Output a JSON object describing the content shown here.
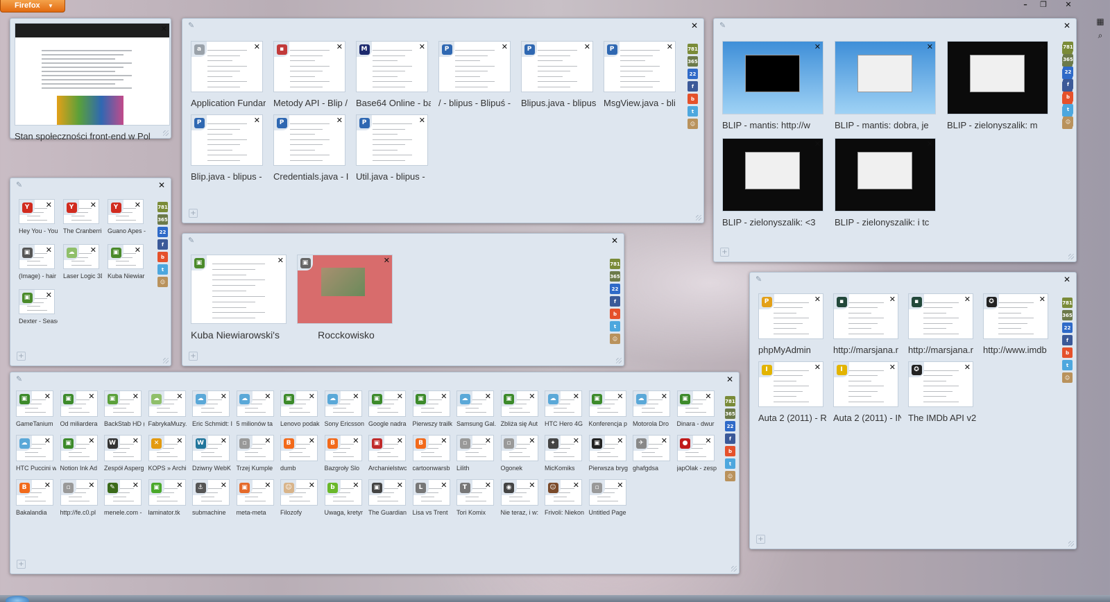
{
  "app": {
    "menu_label": "Firefox"
  },
  "window_controls": {
    "minimize": "–",
    "restore": "❐",
    "close": "✕"
  },
  "colors": {
    "group_bg": "#dee6ef",
    "group_border": "#b5c3d3",
    "firefox_orange": "#e8720c"
  },
  "app_tabs": [
    {
      "name": "counter-781",
      "color": "#7a8b38",
      "label": "781"
    },
    {
      "name": "counter-365",
      "color": "#6c7a4a",
      "label": "365"
    },
    {
      "name": "calendar-22",
      "color": "#2f6ac8",
      "label": "22"
    },
    {
      "name": "facebook",
      "color": "#3b5998",
      "label": "f"
    },
    {
      "name": "blip",
      "color": "#e5512b",
      "label": "b"
    },
    {
      "name": "twitter",
      "color": "#4da7de",
      "label": "t"
    },
    {
      "name": "avatar",
      "color": "#b9925c",
      "label": "☺"
    }
  ],
  "groups": {
    "g1": {
      "tabs": [
        {
          "title": "Stan społeczności front-end w Pol"
        }
      ]
    },
    "g2": {
      "tabs": [
        {
          "title": "Application Fundar",
          "icon": "a",
          "icon_color": "#9aa2aa"
        },
        {
          "title": "Metody API - Blip /",
          "icon": "▪",
          "icon_color": "#c23a3a"
        },
        {
          "title": "Base64 Online - ba",
          "icon": "M",
          "icon_color": "#1d2a6e"
        },
        {
          "title": "/ - blipus - Blipuś -",
          "icon": "P",
          "icon_color": "#2f68b2"
        },
        {
          "title": "Blipus.java - blipus",
          "icon": "P",
          "icon_color": "#2f68b2"
        },
        {
          "title": "MsgView.java - bli",
          "icon": "P",
          "icon_color": "#2f68b2"
        },
        {
          "title": "Blip.java - blipus -",
          "icon": "P",
          "icon_color": "#2f68b2"
        },
        {
          "title": "Credentials.java - I",
          "icon": "P",
          "icon_color": "#2f68b2"
        },
        {
          "title": "Util.java - blipus -",
          "icon": "P",
          "icon_color": "#2f68b2"
        }
      ]
    },
    "g3": {
      "tabs": [
        {
          "title": "BLIP - mantis: http://w"
        },
        {
          "title": "BLIP - mantis: dobra, je"
        },
        {
          "title": "BLIP - zielonyszalik: m"
        },
        {
          "title": "BLIP - zielonyszalik: <3"
        },
        {
          "title": "BLIP - zielonyszalik: i tc"
        }
      ]
    },
    "g4": {
      "tabs": [
        {
          "title": "Hey You - You",
          "icon": "Y",
          "icon_color": "#d12b1f"
        },
        {
          "title": "The Cranberri",
          "icon": "Y",
          "icon_color": "#d12b1f"
        },
        {
          "title": "Guano Apes -",
          "icon": "Y",
          "icon_color": "#d12b1f"
        },
        {
          "title": "(Image) - hair",
          "icon": "▣",
          "icon_color": "#555"
        },
        {
          "title": "Laser Logic 3D",
          "icon": "☁",
          "icon_color": "#8fbf6a"
        },
        {
          "title": "Kuba Niewiar",
          "icon": "▣",
          "icon_color": "#4a8a2a"
        },
        {
          "title": "Dexter - Seasc",
          "icon": "▣",
          "icon_color": "#4a8a2a"
        }
      ]
    },
    "g5": {
      "tabs": [
        {
          "title": "Kuba Niewiarowski's",
          "icon": "▣",
          "icon_color": "#4a8a2a"
        },
        {
          "title": "Rocckowisko",
          "icon": "▣",
          "icon_color": "#666"
        }
      ]
    },
    "g6": {
      "tabs": [
        {
          "title": "phpMyAdmin",
          "icon": "P",
          "icon_color": "#e3a018"
        },
        {
          "title": "http://marsjana.r",
          "icon": "▪",
          "icon_color": "#22483a"
        },
        {
          "title": "http://marsjana.r",
          "icon": "▪",
          "icon_color": "#22483a"
        },
        {
          "title": "http://www.imdb",
          "icon": "✪",
          "icon_color": "#222"
        },
        {
          "title": "Auta 2 (2011) - R",
          "icon": "I",
          "icon_color": "#e3b400"
        },
        {
          "title": "Auta 2 (2011) - IN",
          "icon": "I",
          "icon_color": "#e3b400"
        },
        {
          "title": "The IMDb API v2",
          "icon": "✪",
          "icon_color": "#222"
        }
      ]
    },
    "g7": {
      "tabs": [
        {
          "title": "GameTanium",
          "icon": "▣",
          "icon_color": "#3c8a2a"
        },
        {
          "title": "Od miliardera",
          "icon": "▣",
          "icon_color": "#3c8a2a"
        },
        {
          "title": "BackStab HD (",
          "icon": "▣",
          "icon_color": "#5aa03a"
        },
        {
          "title": "FabrykaMuzy.",
          "icon": "☁",
          "icon_color": "#8fbf6a"
        },
        {
          "title": "Eric Schmidt: I",
          "icon": "☁",
          "icon_color": "#5aa8d8"
        },
        {
          "title": "5 milionów ta",
          "icon": "☁",
          "icon_color": "#5aa8d8"
        },
        {
          "title": "Lenovo podak",
          "icon": "▣",
          "icon_color": "#3c8a2a"
        },
        {
          "title": "Sony Ericsson",
          "icon": "☁",
          "icon_color": "#5aa8d8"
        },
        {
          "title": "Google nadra",
          "icon": "▣",
          "icon_color": "#3c8a2a"
        },
        {
          "title": "Pierwszy trailk",
          "icon": "▣",
          "icon_color": "#3c8a2a"
        },
        {
          "title": "Samsung Gal.",
          "icon": "☁",
          "icon_color": "#5aa8d8"
        },
        {
          "title": "Zbliża się Aut",
          "icon": "▣",
          "icon_color": "#3c8a2a"
        },
        {
          "title": "HTC Hero 4G",
          "icon": "☁",
          "icon_color": "#5aa8d8"
        },
        {
          "title": "Konferencja p",
          "icon": "▣",
          "icon_color": "#3c8a2a"
        },
        {
          "title": "Motorola Dro",
          "icon": "☁",
          "icon_color": "#5aa8d8"
        },
        {
          "title": "Dinara - dwur",
          "icon": "▣",
          "icon_color": "#3c8a2a"
        },
        {
          "title": "HTC Puccini w",
          "icon": "☁",
          "icon_color": "#5aa8d8"
        },
        {
          "title": "Notion Ink Ad",
          "icon": "▣",
          "icon_color": "#3c8a2a"
        },
        {
          "title": "Zespół Asperg",
          "icon": "W",
          "icon_color": "#333"
        },
        {
          "title": "KOPS » Archi",
          "icon": "✕",
          "icon_color": "#e39a10"
        },
        {
          "title": "Dziwny WebK",
          "icon": "W",
          "icon_color": "#21759b"
        },
        {
          "title": "Trzej Kumple",
          "icon": "▫",
          "icon_color": "#999"
        },
        {
          "title": "dumb",
          "icon": "B",
          "icon_color": "#f26a1b"
        },
        {
          "title": "Bazgroły Slo",
          "icon": "B",
          "icon_color": "#f26a1b"
        },
        {
          "title": "Archanielstwc",
          "icon": "▣",
          "icon_color": "#c02a2a"
        },
        {
          "title": "cartoonwarsb",
          "icon": "B",
          "icon_color": "#f26a1b"
        },
        {
          "title": "Lilith",
          "icon": "▫",
          "icon_color": "#999"
        },
        {
          "title": "Ogonek",
          "icon": "▫",
          "icon_color": "#999"
        },
        {
          "title": "MicKomiks",
          "icon": "✦",
          "icon_color": "#444"
        },
        {
          "title": "Pierwsza bryg",
          "icon": "▣",
          "icon_color": "#222"
        },
        {
          "title": "ghafgdsa",
          "icon": "✈",
          "icon_color": "#888"
        },
        {
          "title": "japOlak - zesp",
          "icon": "●",
          "icon_color": "#c01a1a"
        },
        {
          "title": "Bakalandia",
          "icon": "B",
          "icon_color": "#f26a1b"
        },
        {
          "title": "http://fe.c0.pl",
          "icon": "▫",
          "icon_color": "#999"
        },
        {
          "title": "menele.com -",
          "icon": "✎",
          "icon_color": "#3a6a1a"
        },
        {
          "title": "laminator.tk",
          "icon": "▣",
          "icon_color": "#4aa82a"
        },
        {
          "title": "submachine",
          "icon": "⚓",
          "icon_color": "#555"
        },
        {
          "title": "meta-meta",
          "icon": "▣",
          "icon_color": "#e56a2a"
        },
        {
          "title": "Filozofy",
          "icon": "☺",
          "icon_color": "#d8b48a"
        },
        {
          "title": "Uwaga, kretyr",
          "icon": "b",
          "icon_color": "#6ab82a"
        },
        {
          "title": "The Guardian",
          "icon": "▣",
          "icon_color": "#444"
        },
        {
          "title": "Lisa vs Trent",
          "icon": "L",
          "icon_color": "#777"
        },
        {
          "title": "Tori Komix",
          "icon": "T",
          "icon_color": "#777"
        },
        {
          "title": "Nie teraz, i w:",
          "icon": "◉",
          "icon_color": "#444"
        },
        {
          "title": "Frivoli: Niekon",
          "icon": "☺",
          "icon_color": "#7a4a2a"
        },
        {
          "title": "Untitled Page",
          "icon": "▫",
          "icon_color": "#999"
        }
      ]
    }
  }
}
